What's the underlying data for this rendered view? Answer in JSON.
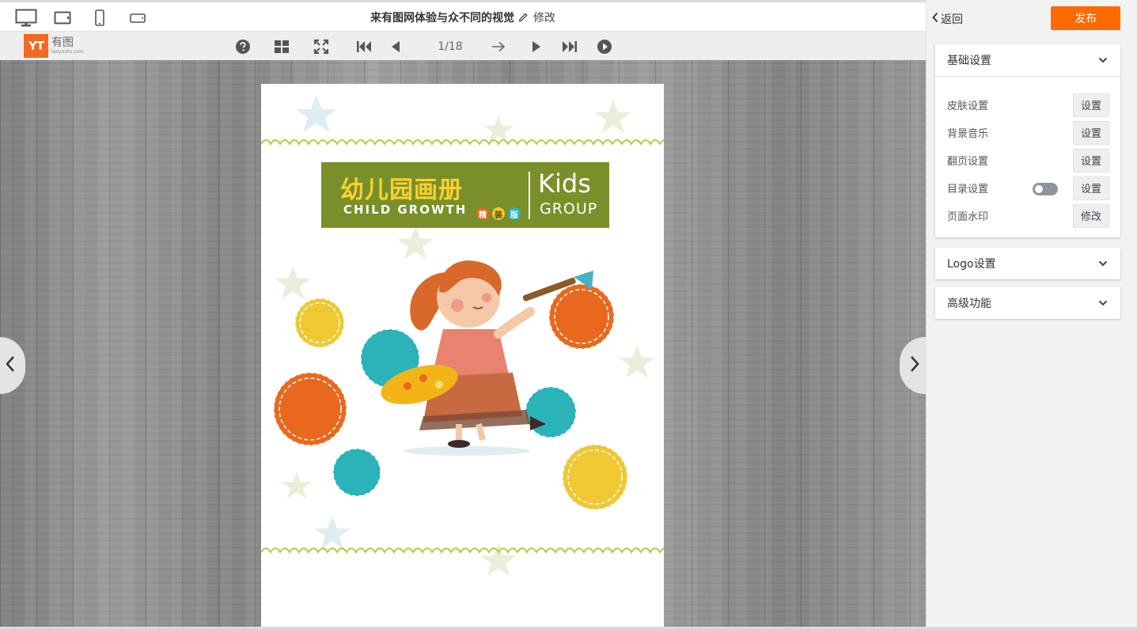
{
  "header": {
    "title": "来有图网体验与众不同的视觉",
    "edit_label": "修改",
    "device_icons": [
      "desktop-icon",
      "tablet-landscape-icon",
      "phone-icon",
      "phone-landscape-icon"
    ]
  },
  "logo": {
    "mark": "YT",
    "name": "有图",
    "url": "laoyoutu.com"
  },
  "toolbar": {
    "icons": [
      "help-icon",
      "thumbnails-icon",
      "fullscreen-icon",
      "first-page-icon",
      "previous-page-icon",
      "next-arrow-icon",
      "play-icon",
      "last-page-icon",
      "autoplay-icon"
    ],
    "page_indicator": "1/18"
  },
  "book": {
    "cover_title_cn": "幼儿园画册",
    "cover_title_en": "CHILD GROWTH",
    "cover_kids": "Kids",
    "cover_group": "GROUP",
    "badges": [
      "精",
      "装",
      "版"
    ]
  },
  "panel": {
    "back_label": "返回",
    "publish_label": "发布",
    "sections": [
      {
        "title": "基础设置",
        "rows": [
          {
            "label": "皮肤设置",
            "button": "设置"
          },
          {
            "label": "背景音乐",
            "button": "设置"
          },
          {
            "label": "翻页设置",
            "button": "设置"
          },
          {
            "label": "目录设置",
            "button": "设置",
            "toggle": false
          },
          {
            "label": "页面水印",
            "button": "修改"
          }
        ]
      },
      {
        "title": "Logo设置"
      },
      {
        "title": "高级功能"
      }
    ]
  },
  "colors": {
    "accent": "#ff6a00",
    "logo": "#f26a21",
    "banner": "#7a8f2a",
    "banner_text": "#f7d22e"
  }
}
